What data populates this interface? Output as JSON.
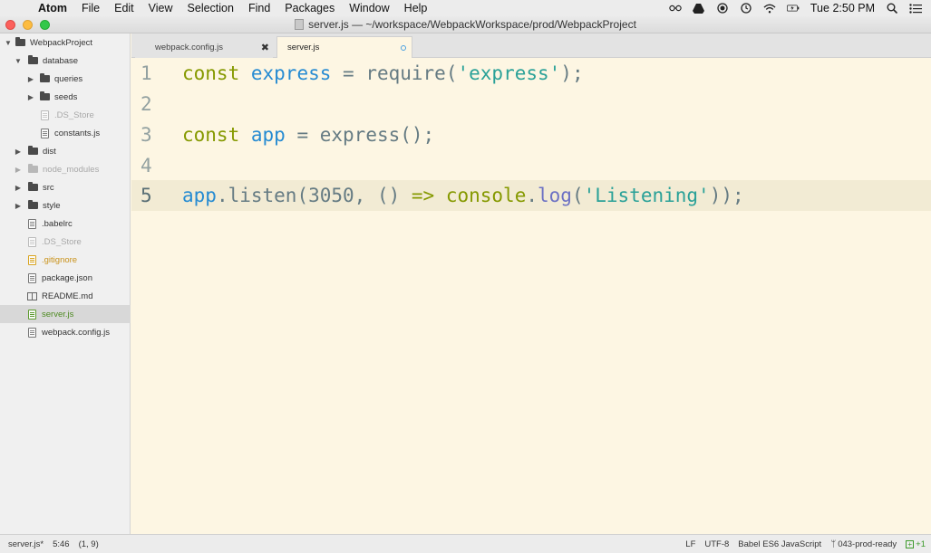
{
  "menubar": {
    "app_name": "Atom",
    "items": [
      "File",
      "Edit",
      "View",
      "Selection",
      "Find",
      "Packages",
      "Window",
      "Help"
    ],
    "clock": "Tue 2:50 PM",
    "status_icons": [
      "glasses-icon",
      "drive-icon",
      "record-icon",
      "time-machine-icon",
      "wifi-icon",
      "battery-icon",
      "spotlight-search-icon",
      "notification-list-icon"
    ]
  },
  "window": {
    "title": "server.js — ~/workspace/WebpackWorkspace/prod/WebpackProject"
  },
  "sidebar": {
    "items": [
      {
        "label": "WebpackProject",
        "type": "folder",
        "expanded": true,
        "depth": 0
      },
      {
        "label": "database",
        "type": "folder",
        "expanded": true,
        "depth": 1
      },
      {
        "label": "queries",
        "type": "folder",
        "expanded": false,
        "depth": 2
      },
      {
        "label": "seeds",
        "type": "folder",
        "expanded": false,
        "depth": 2
      },
      {
        "label": ".DS_Store",
        "type": "file",
        "status": "ignored",
        "depth": 2
      },
      {
        "label": "constants.js",
        "type": "file",
        "depth": 2
      },
      {
        "label": "dist",
        "type": "folder",
        "expanded": false,
        "depth": 1
      },
      {
        "label": "node_modules",
        "type": "folder",
        "expanded": false,
        "status": "ignored",
        "depth": 1
      },
      {
        "label": "src",
        "type": "folder",
        "expanded": false,
        "depth": 1
      },
      {
        "label": "style",
        "type": "folder",
        "expanded": false,
        "depth": 1
      },
      {
        "label": ".babelrc",
        "type": "file",
        "depth": 1
      },
      {
        "label": ".DS_Store",
        "type": "file",
        "status": "ignored",
        "depth": 1
      },
      {
        "label": ".gitignore",
        "type": "file",
        "status": "modified",
        "depth": 1
      },
      {
        "label": "package.json",
        "type": "file",
        "depth": 1
      },
      {
        "label": "README.md",
        "type": "book",
        "depth": 1
      },
      {
        "label": "server.js",
        "type": "file",
        "status": "added",
        "selected": true,
        "depth": 1
      },
      {
        "label": "webpack.config.js",
        "type": "file",
        "depth": 1
      }
    ]
  },
  "tabs": [
    {
      "label": "webpack.config.js",
      "active": false
    },
    {
      "label": "server.js",
      "active": true,
      "modified": true
    }
  ],
  "editor": {
    "line_numbers": [
      "1",
      "2",
      "3",
      "4",
      "5"
    ],
    "current_line": 5,
    "lines": [
      [
        {
          "t": "const",
          "c": "kw"
        },
        {
          "t": " ",
          "c": "plain"
        },
        {
          "t": "express",
          "c": "var"
        },
        {
          "t": " = ",
          "c": "plain"
        },
        {
          "t": "require",
          "c": "fn"
        },
        {
          "t": "(",
          "c": "plain"
        },
        {
          "t": "'express'",
          "c": "str"
        },
        {
          "t": ");",
          "c": "plain"
        }
      ],
      [],
      [
        {
          "t": "const",
          "c": "kw"
        },
        {
          "t": " ",
          "c": "plain"
        },
        {
          "t": "app",
          "c": "var"
        },
        {
          "t": " = ",
          "c": "plain"
        },
        {
          "t": "express",
          "c": "fn"
        },
        {
          "t": "();",
          "c": "plain"
        }
      ],
      [],
      [
        {
          "t": "app",
          "c": "var"
        },
        {
          "t": ".",
          "c": "plain"
        },
        {
          "t": "listen",
          "c": "fn"
        },
        {
          "t": "(3050, () ",
          "c": "plain"
        },
        {
          "t": "=>",
          "c": "op"
        },
        {
          "t": " ",
          "c": "plain"
        },
        {
          "t": "console",
          "c": "kw"
        },
        {
          "t": ".",
          "c": "plain"
        },
        {
          "t": "log",
          "c": "log"
        },
        {
          "t": "(",
          "c": "plain"
        },
        {
          "t": "'Listening'",
          "c": "str hl"
        },
        {
          "t": "));",
          "c": "plain"
        }
      ]
    ]
  },
  "statusbar": {
    "file": "server.js*",
    "cursor": "5:46",
    "selection": "(1, 9)",
    "line_ending": "LF",
    "encoding": "UTF-8",
    "grammar": "Babel ES6 JavaScript",
    "branch": "043-prod-ready",
    "diff": "+1"
  },
  "colors": {
    "editor_bg": "#fdf6e3",
    "keyword": "#859900",
    "variable": "#268bd2",
    "string": "#2aa198"
  }
}
